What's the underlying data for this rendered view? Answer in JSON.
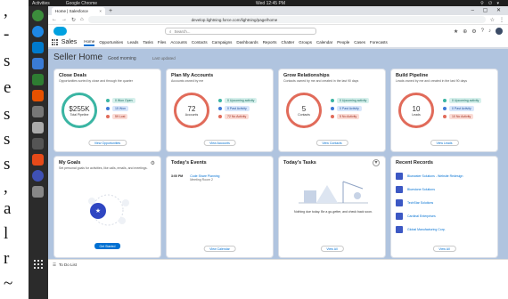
{
  "page_fragments": [
    ",",
    "-",
    "s",
    "e",
    "s",
    "s",
    "s",
    ",",
    "a",
    "l",
    "r",
    "~"
  ],
  "system_bar": {
    "left": "Activities",
    "app": "Google Chrome",
    "clock": "Wed 12:45 PM",
    "tray": "⚲ ⏻ ▾"
  },
  "browser": {
    "tab_title": "Home | Salesforce",
    "url_text": "develop.lightning.force.com/lightning/page/home",
    "window_controls": "– ▢ ✕"
  },
  "salesforce": {
    "search_placeholder": "Search...",
    "app_name": "Sales",
    "nav": [
      "Home",
      "Opportunities",
      "Leads",
      "Tasks",
      "Files",
      "Accounts",
      "Contacts",
      "Campaigns",
      "Dashboards",
      "Reports",
      "Chatter",
      "Groups",
      "Calendar",
      "People",
      "Cases",
      "Forecasts"
    ],
    "home_title": "Seller Home",
    "home_sub": "Good morning",
    "home_updated": "Last updated",
    "cards": {
      "close_deals": {
        "title": "Close Deals",
        "sub": "Opportunities sorted by close and through the quarter",
        "ring_value": "$255K",
        "ring_label": "Total Pipeline",
        "legend": [
          "0 Won Open",
          "15 Won",
          "59 Lost"
        ],
        "button": "View Opportunities"
      },
      "plan_accounts": {
        "title": "Plan My Accounts",
        "sub": "Accounts owned by me",
        "ring_value": "72",
        "ring_label": "Accounts",
        "legend": [
          "0 Upcoming activity",
          "0 Past Activity",
          "72 No Activity"
        ],
        "button": "View Accounts"
      },
      "grow_relationships": {
        "title": "Grow Relationships",
        "sub": "Contacts owned by me and created in the last 90 days",
        "ring_value": "5",
        "ring_label": "Contacts",
        "legend": [
          "0 Upcoming activity",
          "0 Past Activity",
          "5 No Activity"
        ],
        "button": "View Contacts"
      },
      "build_pipeline": {
        "title": "Build Pipeline",
        "sub": "Leads owned by me and created in the last 90 days",
        "ring_value": "10",
        "ring_label": "Leads",
        "legend": [
          "0 Upcoming activity",
          "0 Past Activity",
          "10 No Activity"
        ],
        "button": "View Leads"
      },
      "my_goals": {
        "title": "My Goals",
        "sub": "Set personal goals for activities, like calls, emails, and meetings.",
        "button": "Get Started"
      },
      "events": {
        "title": "Today's Events",
        "time": "3:00 PM",
        "event_name": "Code Share Planning",
        "event_meta": "Meeting Room 2",
        "button": "View Calendar"
      },
      "tasks": {
        "title": "Today's Tasks",
        "message": "Nothing due today. Be a go-getter, and check back soon.",
        "button": "View All"
      },
      "recent": {
        "title": "Recent Records",
        "items": [
          "Bluewater Solutions - Website Redesign",
          "Bluestone Solutions",
          "TechStar Solutions",
          "Cardinal Enterprises",
          "Global Manufacturing Corp."
        ],
        "button": "View All"
      }
    }
  },
  "statusbar": {
    "text": "To Do List"
  }
}
